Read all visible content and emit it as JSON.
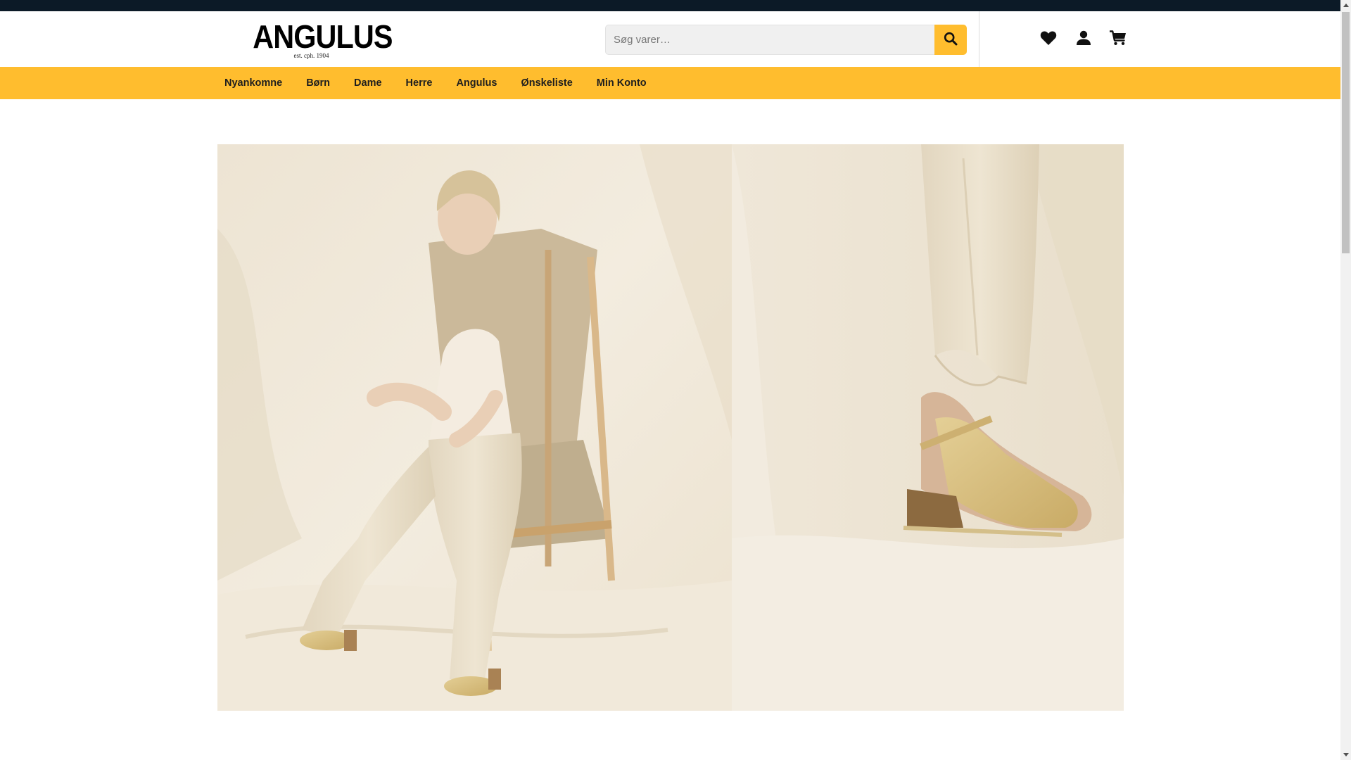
{
  "brand": {
    "name": "ANGULUS",
    "tagline": "est. cph. 1904"
  },
  "search": {
    "placeholder": "Søg varer…",
    "button_icon": "search-icon"
  },
  "header_icons": [
    "heart-icon",
    "user-icon",
    "cart-icon"
  ],
  "nav": {
    "items": [
      {
        "label": "Nyankomne"
      },
      {
        "label": "Børn"
      },
      {
        "label": "Dame"
      },
      {
        "label": "Herre"
      },
      {
        "label": "Angulus"
      },
      {
        "label": "Ønskeliste"
      },
      {
        "label": "Min Konto"
      }
    ]
  },
  "hero": {
    "image": "campaign-photo-woman-seated-in-chair-wearing-woven-gold-sandals"
  },
  "colors": {
    "topbar": "#0c1a27",
    "accent": "#ffbd2e",
    "nav_text": "#1e1e1e",
    "icon": "#111111"
  }
}
